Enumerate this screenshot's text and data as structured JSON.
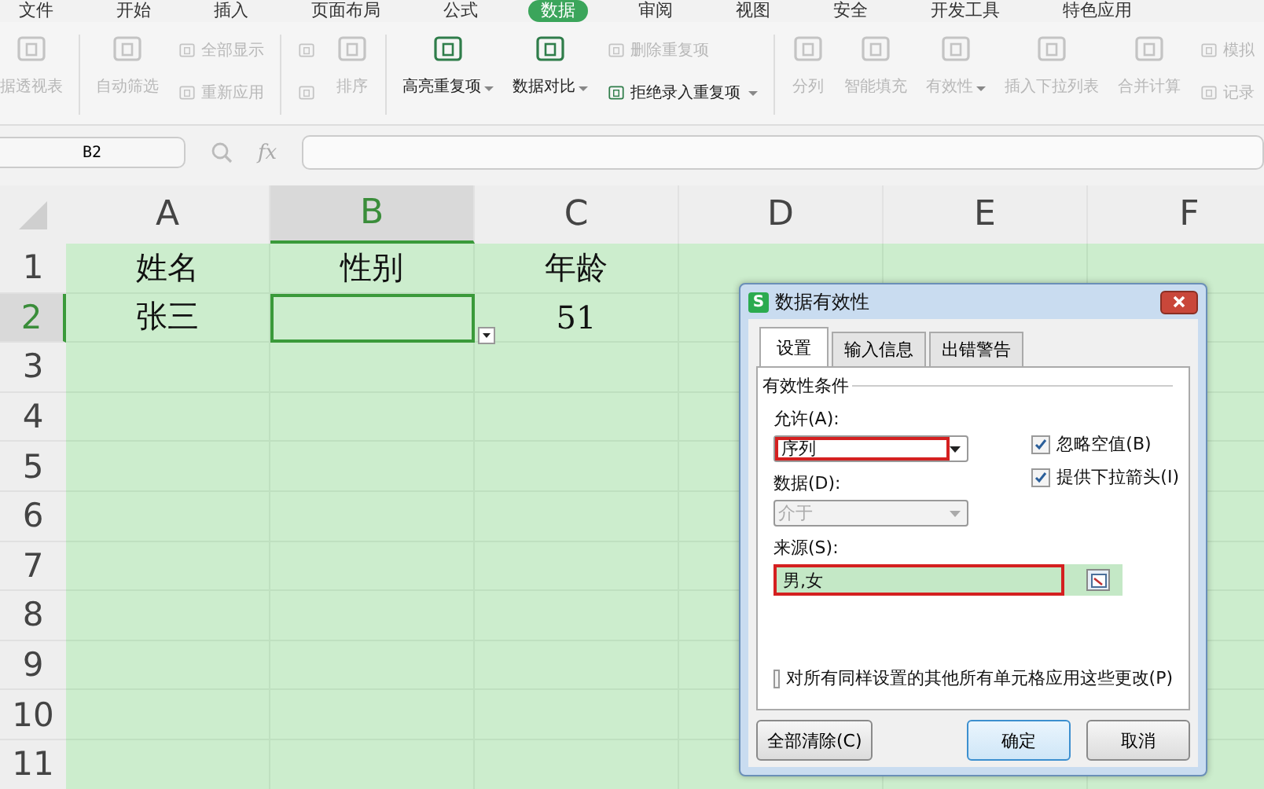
{
  "menu_tabs": [
    {
      "label": "文件",
      "selected": false
    },
    {
      "label": "开始",
      "selected": false
    },
    {
      "label": "插入",
      "selected": false
    },
    {
      "label": "页面布局",
      "selected": false
    },
    {
      "label": "公式",
      "selected": false
    },
    {
      "label": "数据",
      "selected": true
    },
    {
      "label": "审阅",
      "selected": false
    },
    {
      "label": "视图",
      "selected": false
    },
    {
      "label": "安全",
      "selected": false
    },
    {
      "label": "开发工具",
      "selected": false
    },
    {
      "label": "特色应用",
      "selected": false
    }
  ],
  "ribbon": {
    "columns": [
      {
        "kind": "large",
        "label": "据透视表",
        "disabled": true,
        "caret": false
      },
      {
        "kind": "separator"
      },
      {
        "kind": "large",
        "label": "自动筛选",
        "disabled": true,
        "caret": false
      },
      {
        "kind": "stack",
        "items": [
          {
            "label": "全部显示",
            "disabled": true,
            "caret": false
          },
          {
            "label": "重新应用",
            "disabled": true,
            "caret": false
          }
        ]
      },
      {
        "kind": "separator"
      },
      {
        "kind": "stack",
        "items": [
          {
            "disabled": true,
            "caret": false
          },
          {
            "disabled": true,
            "caret": false
          }
        ]
      },
      {
        "kind": "large",
        "label": "排序",
        "disabled": true,
        "caret": false
      },
      {
        "kind": "separator"
      },
      {
        "kind": "large",
        "label": "高亮重复项",
        "disabled": false,
        "caret": true
      },
      {
        "kind": "large",
        "label": "数据对比",
        "disabled": false,
        "caret": true
      },
      {
        "kind": "stack",
        "items": [
          {
            "label": "删除重复项",
            "disabled": true,
            "caret": false
          },
          {
            "label": "拒绝录入重复项",
            "disabled": false,
            "caret": true
          }
        ]
      },
      {
        "kind": "separator"
      },
      {
        "kind": "large",
        "label": "分列",
        "disabled": true,
        "caret": false
      },
      {
        "kind": "large",
        "label": "智能填充",
        "disabled": true,
        "caret": false
      },
      {
        "kind": "large",
        "label": "有效性",
        "disabled": true,
        "caret": true
      },
      {
        "kind": "large",
        "label": "插入下拉列表",
        "disabled": true,
        "caret": false
      },
      {
        "kind": "large",
        "label": "合并计算",
        "disabled": true,
        "caret": false
      },
      {
        "kind": "stack",
        "items": [
          {
            "label": "模拟",
            "disabled": true,
            "caret": false
          },
          {
            "label": "记录",
            "disabled": true,
            "caret": false
          }
        ]
      }
    ]
  },
  "name_box": {
    "value": "B2"
  },
  "formula_bar": {
    "label": "fx"
  },
  "sheet": {
    "columns": [
      {
        "label": "A",
        "selected": false
      },
      {
        "label": "B",
        "selected": true
      },
      {
        "label": "C",
        "selected": false
      },
      {
        "label": "D",
        "selected": false
      },
      {
        "label": "E",
        "selected": false
      },
      {
        "label": "F",
        "selected": false
      }
    ],
    "rows": [
      {
        "label": "1",
        "selected": false,
        "cells": [
          {
            "text": "姓名",
            "selected": false
          },
          {
            "text": "性别",
            "selected": false
          },
          {
            "text": "年龄",
            "selected": false
          }
        ]
      },
      {
        "label": "2",
        "selected": true,
        "cells": [
          {
            "text": "张三",
            "selected": false
          },
          {
            "selected": true,
            "dropdown": true
          },
          {
            "text": "51",
            "selected": false
          }
        ]
      },
      {
        "label": "3",
        "selected": false,
        "cells": []
      },
      {
        "label": "4",
        "selected": false,
        "cells": []
      },
      {
        "label": "5",
        "selected": false,
        "cells": []
      },
      {
        "label": "6",
        "selected": false,
        "cells": []
      },
      {
        "label": "7",
        "selected": false,
        "cells": []
      },
      {
        "label": "8",
        "selected": false,
        "cells": []
      },
      {
        "label": "9",
        "selected": false,
        "cells": []
      },
      {
        "label": "10",
        "selected": false,
        "cells": []
      },
      {
        "label": "11",
        "selected": false,
        "cells": []
      }
    ]
  },
  "dialog": {
    "title": "数据有效性",
    "app_badge": "S",
    "tabs": [
      {
        "label": "设置",
        "selected": true
      },
      {
        "label": "输入信息",
        "selected": false
      },
      {
        "label": "出错警告",
        "selected": false
      }
    ],
    "group_title": "有效性条件",
    "allow": {
      "label": "允许(A):",
      "value": "序列",
      "highlighted": true,
      "disabled": false
    },
    "data": {
      "label": "数据(D):",
      "value": "介于",
      "highlighted": false,
      "disabled": true
    },
    "source": {
      "label": "来源(S):",
      "value": "男,女",
      "highlighted": true
    },
    "options": [
      {
        "label": "忽略空值(B)",
        "checked": true
      },
      {
        "label": "提供下拉箭头(I)",
        "checked": true
      }
    ],
    "apply_all": {
      "label": "对所有同样设置的其他所有单元格应用这些更改(P)",
      "checked": false
    },
    "buttons": [
      {
        "label": "全部清除(C)",
        "kind": "secondary"
      },
      {
        "label": "确定",
        "kind": "default"
      },
      {
        "label": "取消",
        "kind": "secondary"
      }
    ]
  }
}
